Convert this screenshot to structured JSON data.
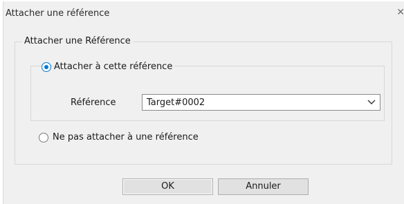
{
  "window": {
    "title": "Attacher une référence",
    "close_glyph": "✕"
  },
  "group": {
    "label": "Attacher une Référence"
  },
  "options": {
    "attach": {
      "label": "Attacher à cette référence",
      "selected": true
    },
    "no_attach": {
      "label": "Ne pas attacher à une référence",
      "selected": false
    }
  },
  "reference": {
    "label": "Référence",
    "value": "Target#0002"
  },
  "buttons": {
    "ok_label": "OK",
    "cancel_label": "Annuler"
  },
  "colors": {
    "accent": "#0078d4",
    "dialog_bg": "#f0f0f0"
  }
}
